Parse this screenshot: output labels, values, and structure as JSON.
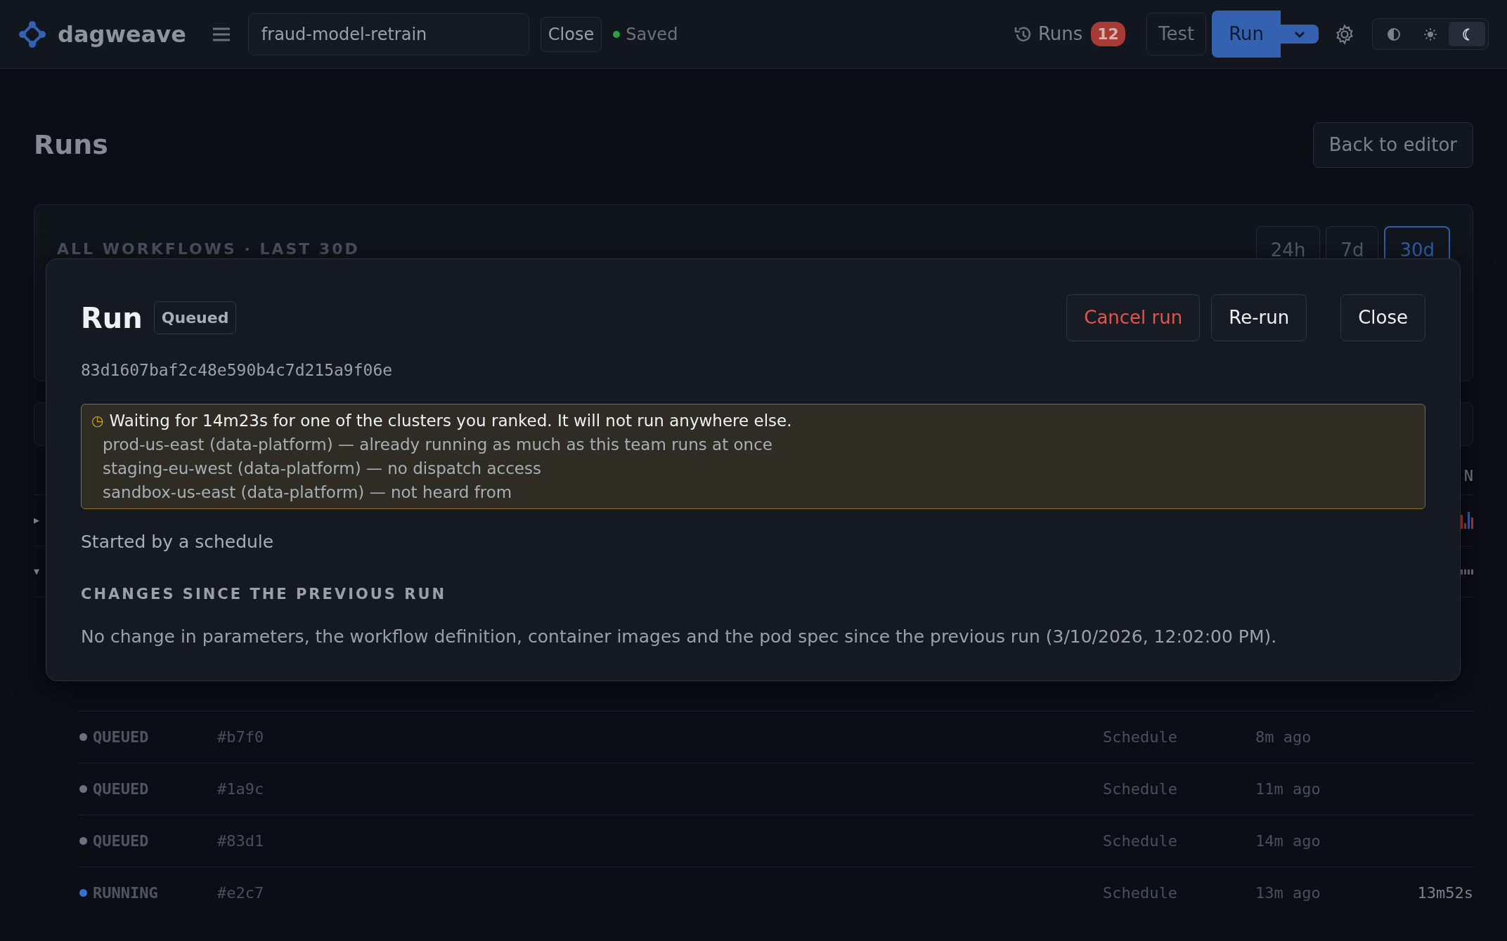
{
  "app": {
    "name": "dagweave"
  },
  "workflow": {
    "value": "fraud-model-retrain"
  },
  "close_label": "Close",
  "save_status": {
    "label": "Saved",
    "saved": true
  },
  "runs_link": {
    "label": "Runs",
    "count": "12"
  },
  "test_label": "Test",
  "run_label": "Run",
  "theme_options": [
    {
      "kind": "auto",
      "selected": false
    },
    {
      "kind": "light",
      "selected": false
    },
    {
      "kind": "dark",
      "selected": true
    }
  ],
  "page": {
    "title": "Runs",
    "back_label": "Back to editor"
  },
  "summary": {
    "heading": "ALL WORKFLOWS · LAST 30D",
    "ranges": [
      {
        "label": "24h",
        "selected": false
      },
      {
        "label": "7d",
        "selected": false
      },
      {
        "label": "30d",
        "selected": true
      }
    ]
  },
  "table": {
    "header_fragment": "N",
    "groups": [
      {
        "toggle": "▸"
      },
      {
        "toggle": "▾"
      }
    ],
    "rows": [
      {
        "status": "QUEUED",
        "color": "#6b7280",
        "id": "#b7f0",
        "trigger": "Schedule",
        "started": "8m ago"
      },
      {
        "status": "QUEUED",
        "color": "#6b7280",
        "id": "#1a9c",
        "trigger": "Schedule",
        "started": "11m ago"
      },
      {
        "status": "QUEUED",
        "color": "#6b7280",
        "id": "#83d1",
        "trigger": "Schedule",
        "started": "14m ago"
      },
      {
        "status": "RUNNING",
        "color": "#3b6fd1",
        "id": "#e2c7",
        "trigger": "Schedule",
        "started": "13m ago",
        "duration": "13m52s"
      }
    ]
  },
  "modal": {
    "title": "Run",
    "badge": "Queued",
    "buttons": [
      {
        "label": "Cancel run",
        "kind": "danger"
      },
      {
        "label": "Re-run",
        "kind": "default"
      },
      {
        "label": "Close",
        "kind": "close"
      }
    ],
    "run_id": "83d1607baf2c48e590b4c7d215a9f06e",
    "notice": {
      "icon": "◷",
      "headline": "Waiting for 14m23s for one of the clusters you ranked. It will not run anywhere else.",
      "reasons": [
        "prod-us-east (data-platform) — already running as much as this team runs at once",
        "staging-eu-west (data-platform) — no dispatch access",
        "sandbox-us-east (data-platform) — not heard from"
      ]
    },
    "started_by": "Started by a schedule",
    "changes_heading": "CHANGES SINCE THE PREVIOUS RUN",
    "changes_text": "No change in parameters, the workflow definition, container images and the pod spec since the previous run (3/10/2026, 12:02:00 PM)."
  }
}
